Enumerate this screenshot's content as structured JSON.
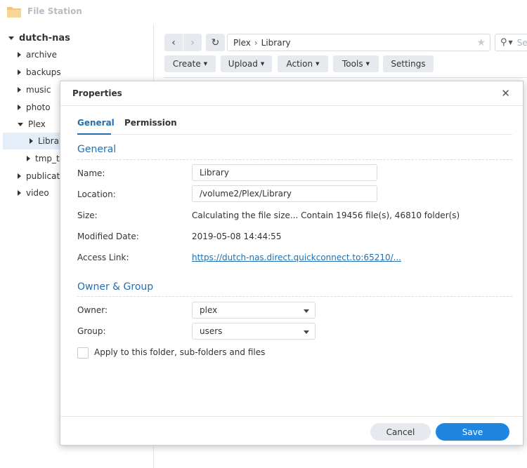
{
  "app": {
    "title": "File Station",
    "icon": "folder-icon"
  },
  "sidebar": {
    "root": "dutch-nas",
    "items": [
      {
        "label": "archive"
      },
      {
        "label": "backups"
      },
      {
        "label": "music"
      },
      {
        "label": "photo"
      },
      {
        "label": "Plex"
      },
      {
        "label": "Library"
      },
      {
        "label": "tmp_t"
      },
      {
        "label": "publicati"
      },
      {
        "label": "video"
      }
    ]
  },
  "toolbar": {
    "path": [
      "Plex",
      "Library"
    ],
    "search_placeholder": "Se",
    "buttons": {
      "create": "Create",
      "upload": "Upload",
      "action": "Action",
      "tools": "Tools",
      "settings": "Settings"
    }
  },
  "dialog": {
    "title": "Properties",
    "tabs": {
      "general": "General",
      "permission": "Permission"
    },
    "general_section": "General",
    "labels": {
      "name": "Name:",
      "location": "Location:",
      "size": "Size:",
      "modified": "Modified Date:",
      "access_link": "Access Link:"
    },
    "values": {
      "name": "Library",
      "location": "/volume2/Plex/Library",
      "size": "Calculating the file size... Contain 19456 file(s), 46810 folder(s)",
      "modified": "2019-05-08 14:44:55",
      "access_link": "https://dutch-nas.direct.quickconnect.to:65210/..."
    },
    "owner_section": "Owner & Group",
    "owner_labels": {
      "owner": "Owner:",
      "group": "Group:"
    },
    "owner_values": {
      "owner": "plex",
      "group": "users"
    },
    "apply_label": "Apply to this folder, sub-folders and files",
    "buttons": {
      "cancel": "Cancel",
      "save": "Save"
    }
  },
  "colors": {
    "accent": "#1f6fb2",
    "primary_button": "#1f86e0",
    "selected_row": "#e3eef9"
  }
}
